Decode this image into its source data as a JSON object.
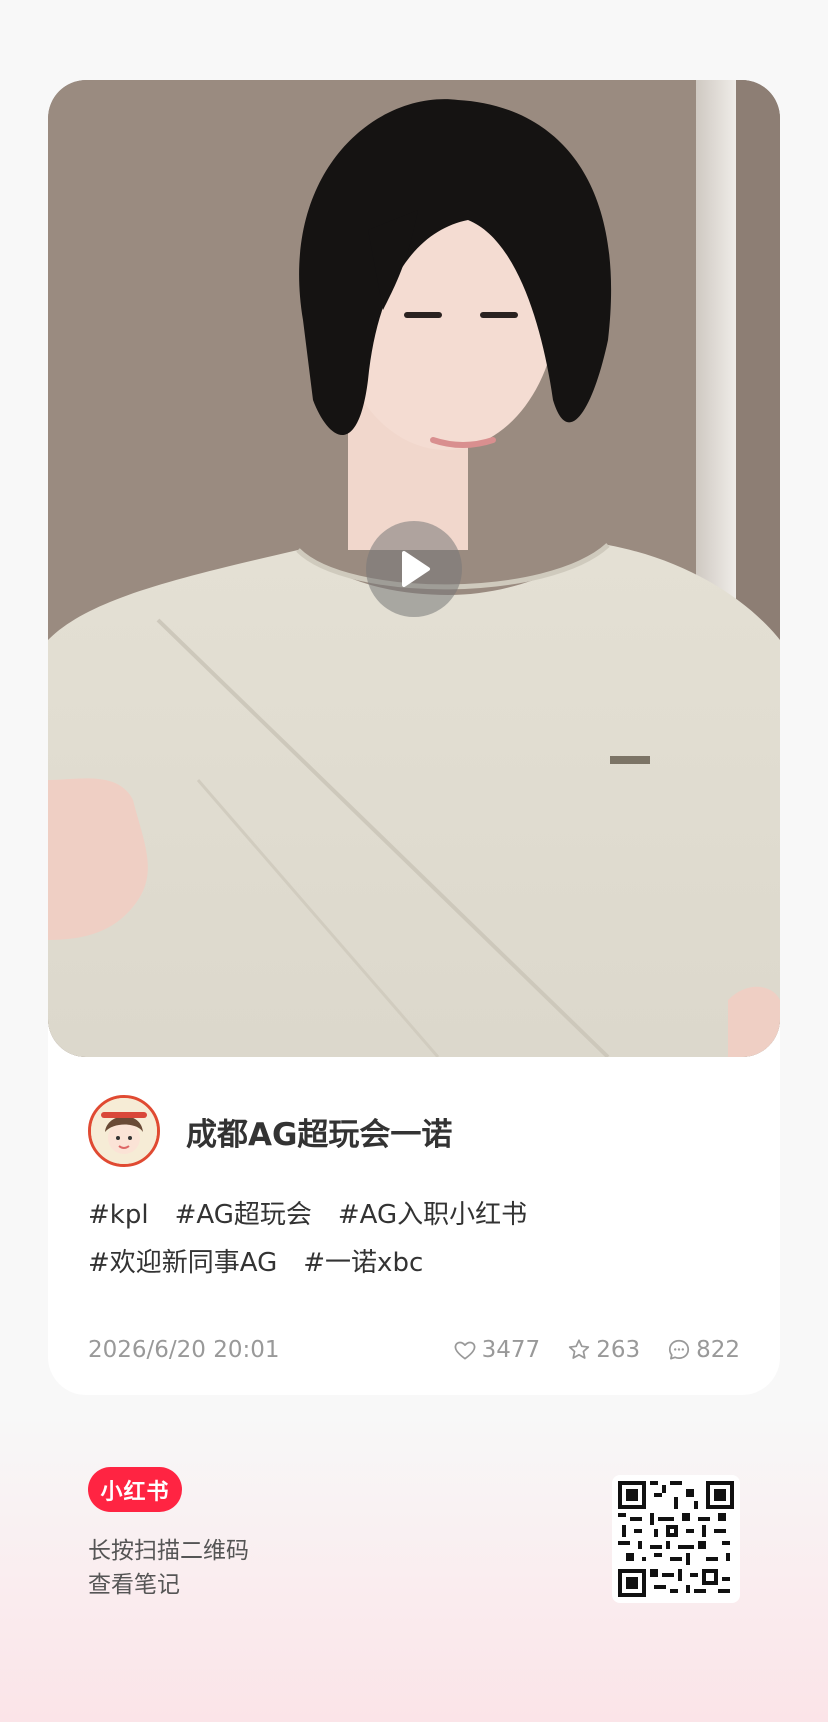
{
  "post": {
    "media_type": "video",
    "play_icon": "play-icon",
    "author_name": "成都AG超玩会一诺",
    "tags": [
      "#kpl",
      "#AG超玩会",
      "#AG入职小红书",
      "#欢迎新同事AG",
      "#一诺xbc"
    ],
    "date": "2026/6/20 20:01",
    "likes": "3477",
    "favorites": "263",
    "comments": "822",
    "like_icon": "heart-icon",
    "favorite_icon": "star-icon",
    "comment_icon": "comment-icon"
  },
  "footer": {
    "logo_text": "小红书",
    "hint_line1": "长按扫描二维码",
    "hint_line2": "查看笔记",
    "qr_icon": "qr-code"
  },
  "colors": {
    "brand": "#ff2442",
    "background": "#f8f8f8",
    "card": "#ffffff",
    "muted_text": "#999999"
  }
}
